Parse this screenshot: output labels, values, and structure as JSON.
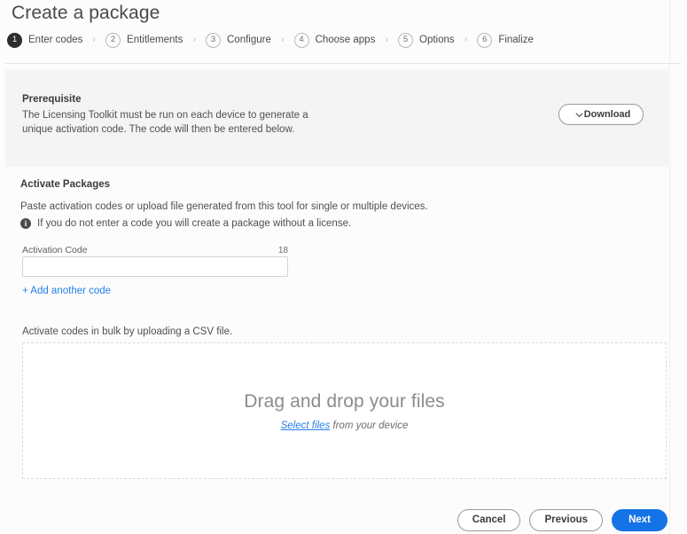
{
  "header": {
    "title": "Create a package"
  },
  "stepper": {
    "separator": "›",
    "steps": [
      {
        "number": "1",
        "label": "Enter codes",
        "current": true
      },
      {
        "number": "2",
        "label": "Entitlements",
        "current": false
      },
      {
        "number": "3",
        "label": "Configure",
        "current": false
      },
      {
        "number": "4",
        "label": "Choose apps",
        "current": false
      },
      {
        "number": "5",
        "label": "Options",
        "current": false
      },
      {
        "number": "6",
        "label": "Finalize",
        "current": false
      }
    ]
  },
  "prerequisite": {
    "title": "Prerequisite",
    "body": "The Licensing Toolkit must be run on each device to generate a unique activation code. The code will then be entered below.",
    "download_label": "Download",
    "download_icon": "chevron-down-icon"
  },
  "activate": {
    "title": "Activate Packages",
    "subtitle": "Paste activation codes or upload file generated from this tool for single or multiple devices.",
    "info_icon": "info-icon",
    "info_text": "If you do not enter a code you will create a package without a license.",
    "field_label": "Activation Code",
    "field_count": "18",
    "field_value": "",
    "field_placeholder": "",
    "add_code_label": "+ Add another code"
  },
  "bulk": {
    "text": "Activate codes in bulk by uploading a CSV file.",
    "dropzone_title": "Drag and drop your files",
    "dropzone_link": "Select files",
    "dropzone_suffix": " from your device"
  },
  "footer": {
    "cancel_label": "Cancel",
    "previous_label": "Previous",
    "next_label": "Next"
  },
  "colors": {
    "accent_blue": "#1473e6",
    "link_blue": "#2680eb",
    "step_active": "#2c2c2c",
    "card_bg": "#f4f4f4"
  }
}
